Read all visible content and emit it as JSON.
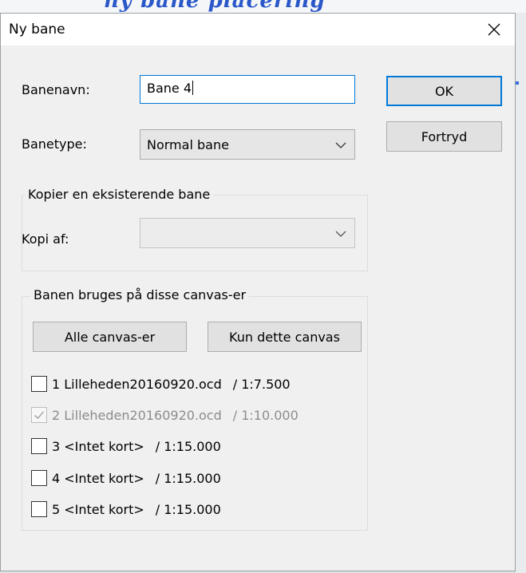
{
  "window": {
    "title": "Ny bane"
  },
  "fields": {
    "banenavn_label": "Banenavn:",
    "banenavn_value": "Bane 4",
    "banetype_label": "Banetype:",
    "banetype_value": "Normal bane"
  },
  "buttons": {
    "ok": "OK",
    "cancel": "Fortryd"
  },
  "copy_group": {
    "legend": "Kopier en eksisterende bane",
    "kopi_label": "Kopi af:",
    "kopi_value": ""
  },
  "canvas_group": {
    "legend": "Banen bruges på disse canvas-er",
    "all_button": "Alle canvas-er",
    "only_button": "Kun dette canvas",
    "items": [
      {
        "name": "1 Lilleheden20160920.ocd",
        "scale": "/ 1:7.500",
        "checked": false,
        "disabled": false
      },
      {
        "name": "2 Lilleheden20160920.ocd",
        "scale": "/ 1:10.000",
        "checked": true,
        "disabled": true
      },
      {
        "name": "3 <Intet kort>",
        "scale": "/ 1:15.000",
        "checked": false,
        "disabled": false
      },
      {
        "name": "4 <Intet kort>",
        "scale": "/ 1:15.000",
        "checked": false,
        "disabled": false
      },
      {
        "name": "5 <Intet kort>",
        "scale": "/ 1:15.000",
        "checked": false,
        "disabled": false
      }
    ]
  },
  "icons": {
    "close": "close-icon",
    "dropdown": "chevron-down-icon",
    "check": "check-icon"
  },
  "colors": {
    "focus_border": "#0078d7",
    "dialog_bg": "#f0f0f0"
  }
}
